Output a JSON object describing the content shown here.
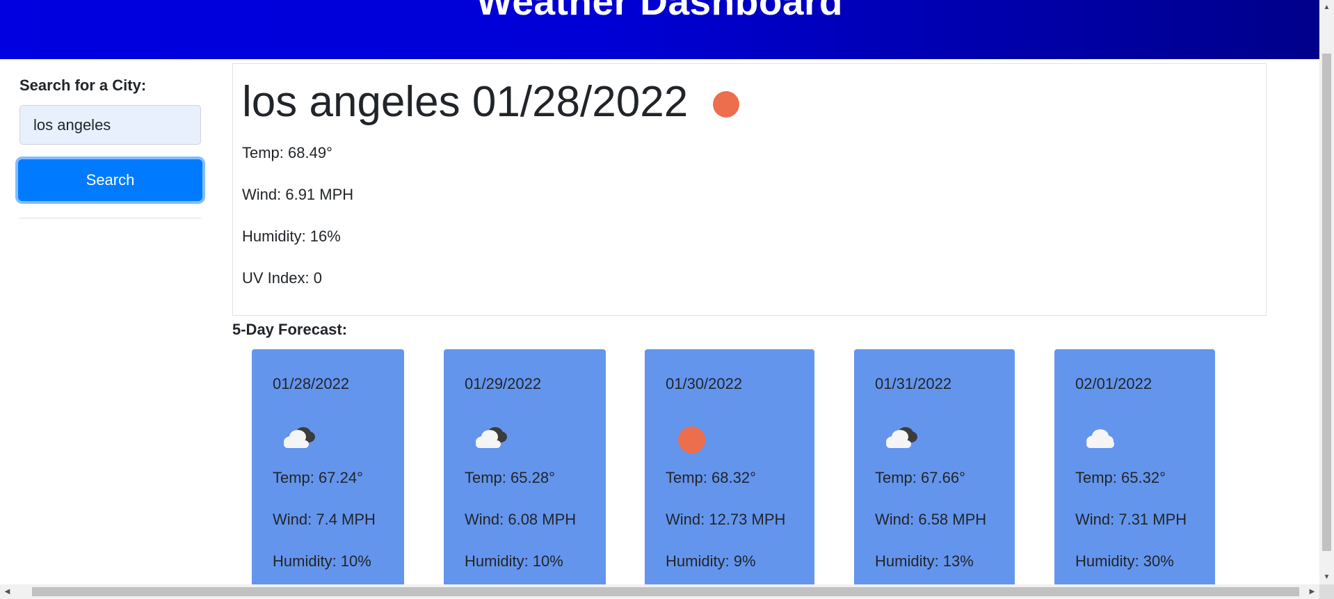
{
  "header": {
    "title": "Weather Dashboard"
  },
  "sidebar": {
    "search_label": "Search for a City:",
    "search_value": "los angeles",
    "search_button": "Search"
  },
  "current": {
    "title": "los angeles 01/28/2022",
    "icon": "sun-icon",
    "temp": "Temp: 68.49°",
    "wind": "Wind: 6.91 MPH",
    "humidity": "Humidity: 16%",
    "uv": "UV Index: 0"
  },
  "forecast": {
    "heading": "5-Day Forecast:",
    "days": [
      {
        "date": "01/28/2022",
        "icon": "cloudy-night-icon",
        "temp": "Temp: 67.24°",
        "wind": "Wind: 7.4 MPH",
        "humidity": "Humidity: 10%"
      },
      {
        "date": "01/29/2022",
        "icon": "cloudy-night-icon",
        "temp": "Temp: 65.28°",
        "wind": "Wind: 6.08 MPH",
        "humidity": "Humidity: 10%"
      },
      {
        "date": "01/30/2022",
        "icon": "sun-icon",
        "temp": "Temp: 68.32°",
        "wind": "Wind: 12.73 MPH",
        "humidity": "Humidity: 9%"
      },
      {
        "date": "01/31/2022",
        "icon": "cloudy-night-icon",
        "temp": "Temp: 67.66°",
        "wind": "Wind: 6.58 MPH",
        "humidity": "Humidity: 13%"
      },
      {
        "date": "02/01/2022",
        "icon": "cloud-icon",
        "temp": "Temp: 65.32°",
        "wind": "Wind: 7.31 MPH",
        "humidity": "Humidity: 30%"
      }
    ]
  },
  "colors": {
    "header_gradient_start": "#0000e0",
    "header_gradient_end": "#00008a",
    "button": "#007bff",
    "card": "#6495ed",
    "sun": "#ec6e4c"
  }
}
